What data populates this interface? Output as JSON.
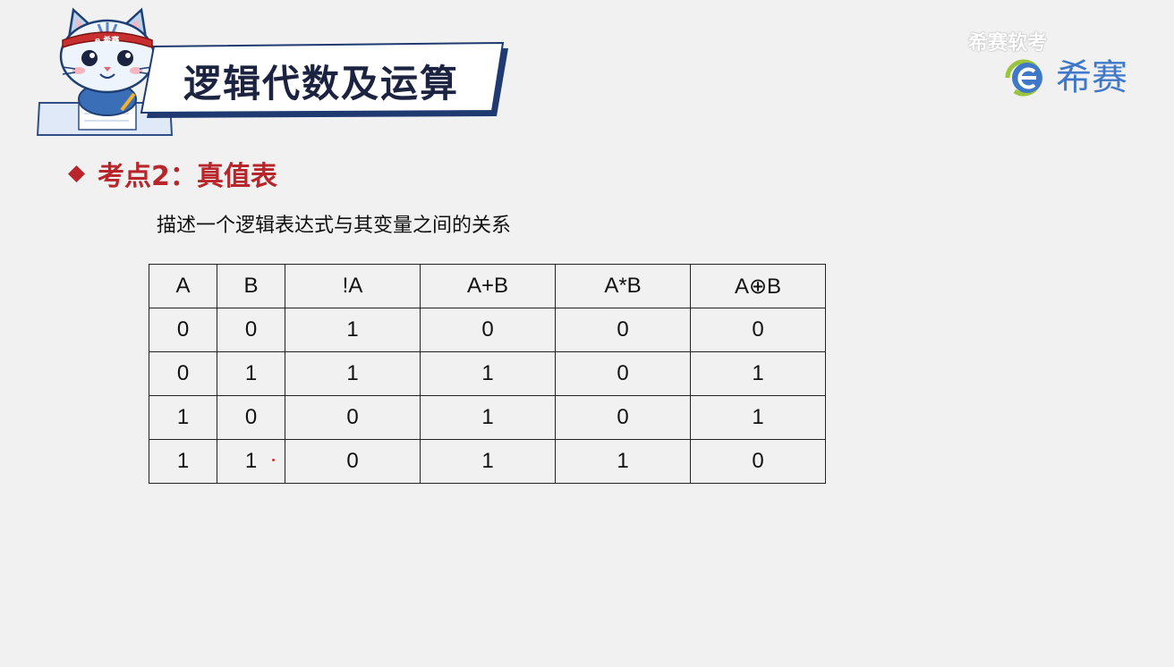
{
  "header": {
    "title": "逻辑代数及运算",
    "mascot_badge": "e 希赛",
    "watermark": "希赛软考"
  },
  "logo": {
    "text": "希赛",
    "icon": "e-logo-icon",
    "color": "#3f78c8"
  },
  "section": {
    "bullet_icon": "diamond-icon",
    "heading": "考点2：真值表",
    "description": "描述一个逻辑表达式与其变量之间的关系",
    "color": "#b8262b"
  },
  "truth_table": {
    "headers": [
      "A",
      "B",
      "!A",
      "A+B",
      "A*B",
      "A⊕B"
    ],
    "rows": [
      [
        "0",
        "0",
        "1",
        "0",
        "0",
        "0"
      ],
      [
        "0",
        "1",
        "1",
        "1",
        "0",
        "1"
      ],
      [
        "1",
        "0",
        "0",
        "1",
        "0",
        "1"
      ],
      [
        "1",
        "1",
        "0",
        "1",
        "1",
        "0"
      ]
    ]
  }
}
